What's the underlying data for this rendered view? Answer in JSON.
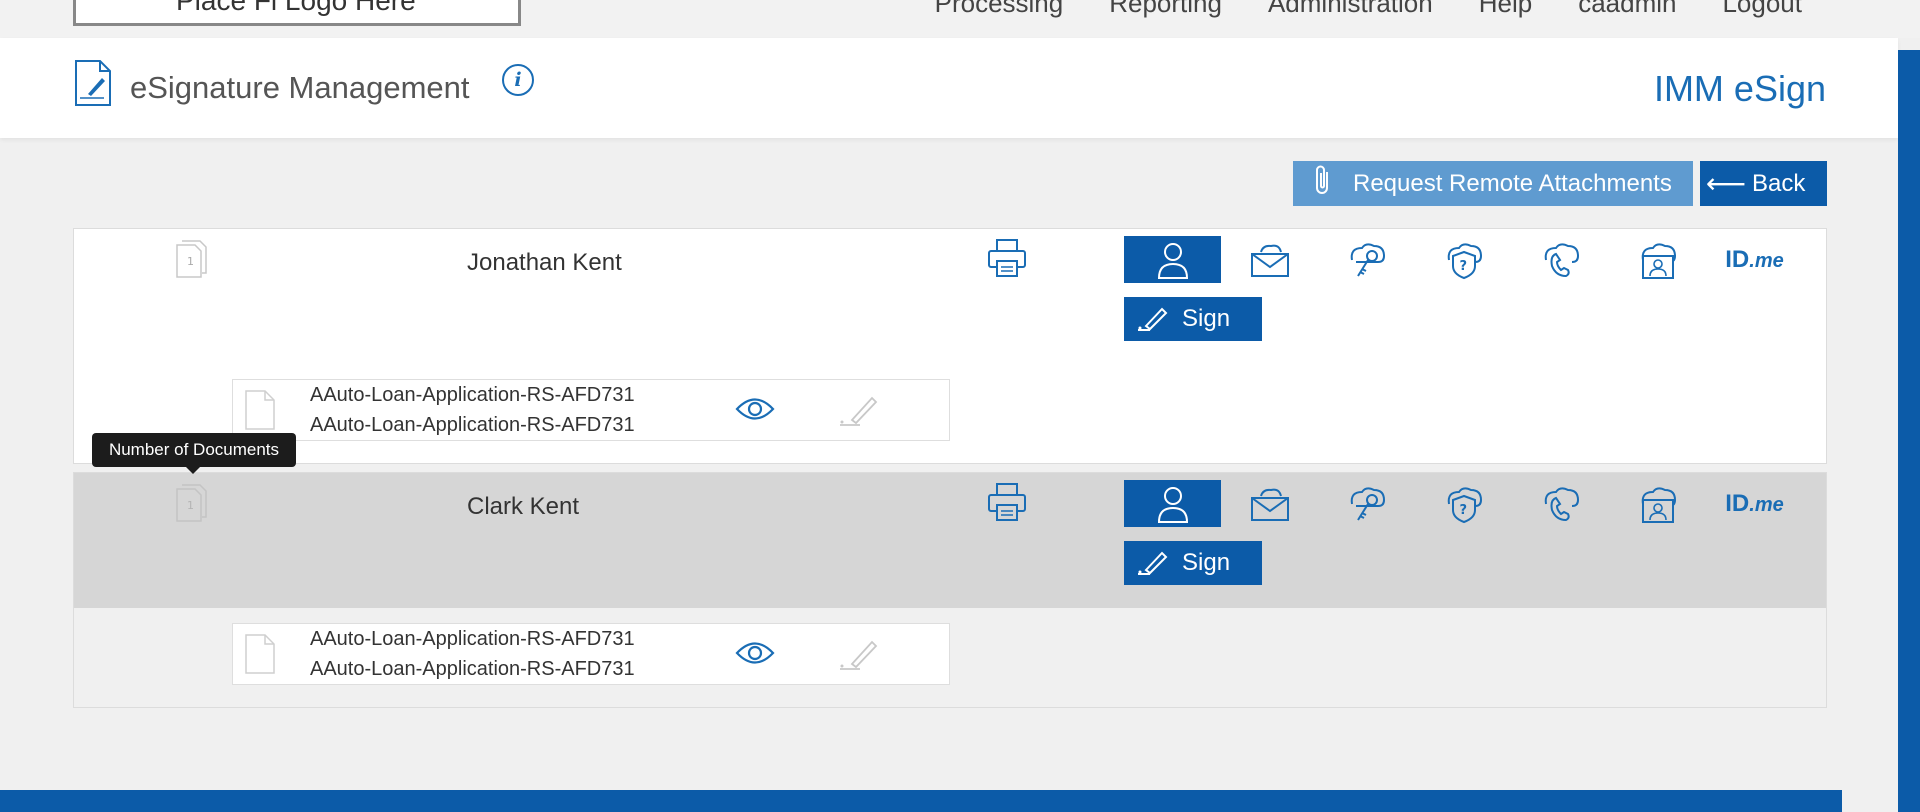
{
  "topbar": {
    "logo_text": "Place Fl Logo Here",
    "nav": [
      "Processing",
      "Reporting",
      "Administration",
      "Help",
      "caadmin",
      "Logout"
    ]
  },
  "header": {
    "title": "eSignature Management",
    "info_icon": "i",
    "brand": "IMM eSign"
  },
  "actions": {
    "attach_label": "Request Remote Attachments",
    "back_label": "Back",
    "back_arrow": "⟵"
  },
  "tooltip": "Number of Documents",
  "signers": [
    {
      "name": "Jonathan Kent",
      "doc_count": "1",
      "sign_label": "Sign",
      "idme_label": "ID.me",
      "documents": [
        {
          "line1": "AAuto-Loan-Application-RS-AFD731",
          "line2": "AAuto-Loan-Application-RS-AFD731"
        }
      ]
    },
    {
      "name": "Clark Kent",
      "doc_count": "1",
      "sign_label": "Sign",
      "idme_label": "ID.me",
      "documents": [
        {
          "line1": "AAuto-Loan-Application-RS-AFD731",
          "line2": "AAuto-Loan-Application-RS-AFD731"
        }
      ]
    }
  ],
  "colors": {
    "primary": "#0c5ba8",
    "attach_button": "#5f9bd0",
    "icon_blue": "#1a6db5",
    "selected_row": "#d6d6d6"
  },
  "icons": {
    "auth_methods": [
      "user-icon",
      "email-icon",
      "key-icon",
      "shield-question-icon",
      "phone-icon",
      "id-card-icon",
      "idme-logo"
    ]
  }
}
